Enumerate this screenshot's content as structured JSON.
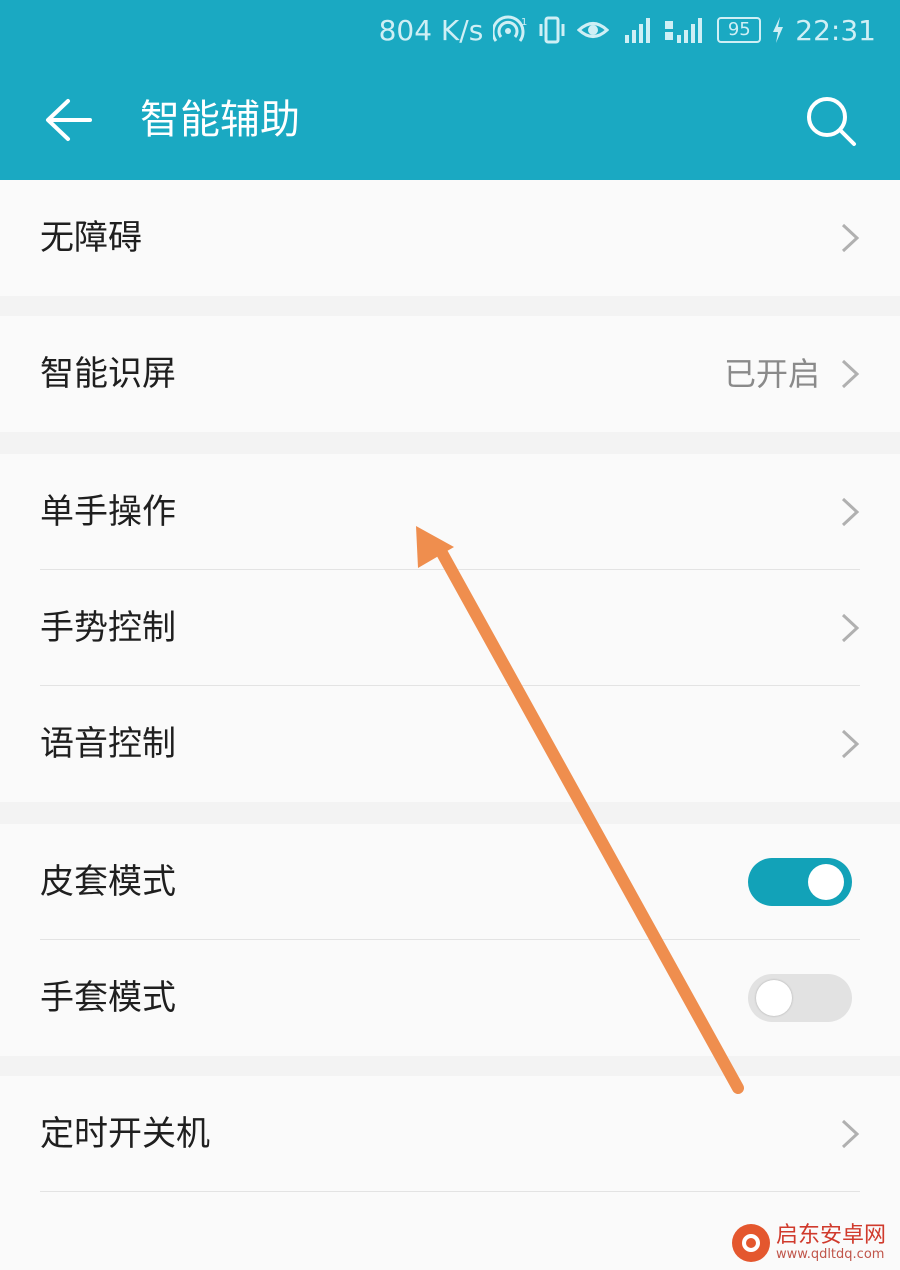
{
  "status_bar": {
    "speed": "804 K/s",
    "battery": "95",
    "time": "22:31",
    "icons": [
      "hotspot-icon",
      "vibrate-icon",
      "eye-comfort-icon",
      "signal-2g-icon",
      "signal-4g-icon",
      "battery-icon",
      "charging-icon"
    ]
  },
  "app_bar": {
    "title": "智能辅助",
    "back_icon": "arrow-left-icon",
    "search_icon": "search-icon"
  },
  "groups": {
    "accessibility": {
      "label": "无障碍"
    },
    "smart_screen": {
      "label": "智能识屏",
      "status": "已开启"
    },
    "one_hand": {
      "label": "单手操作"
    },
    "gesture": {
      "label": "手势控制"
    },
    "voice": {
      "label": "语音控制"
    },
    "cover_mode": {
      "label": "皮套模式",
      "on": true
    },
    "glove_mode": {
      "label": "手套模式",
      "on": false
    },
    "schedule_power": {
      "label": "定时开关机"
    }
  },
  "colors": {
    "accent": "#1aa9c2",
    "toggle_on": "#12a2b8",
    "annotation_arrow": "#ef8e4e"
  },
  "watermark": {
    "text": "启东安卓网",
    "url": "www.qdltdq.com"
  }
}
